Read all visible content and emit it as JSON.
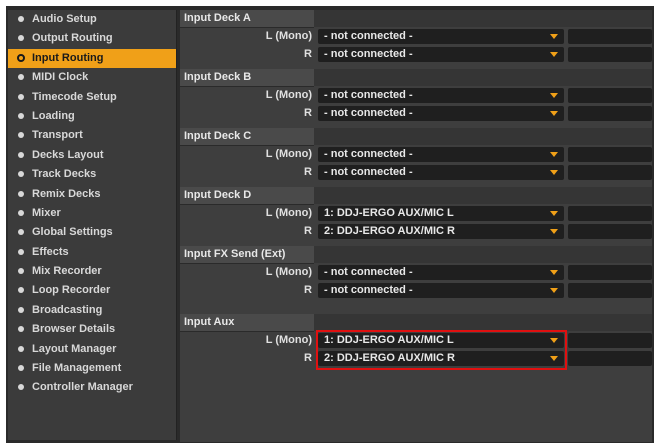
{
  "sidebar": {
    "items": [
      {
        "label": "Audio Setup"
      },
      {
        "label": "Output Routing"
      },
      {
        "label": "Input Routing",
        "active": true
      },
      {
        "label": "MIDI Clock"
      },
      {
        "label": "Timecode Setup"
      },
      {
        "label": "Loading"
      },
      {
        "label": "Transport"
      },
      {
        "label": "Decks Layout"
      },
      {
        "label": "Track Decks"
      },
      {
        "label": "Remix Decks"
      },
      {
        "label": "Mixer"
      },
      {
        "label": "Global Settings"
      },
      {
        "label": "Effects"
      },
      {
        "label": "Mix Recorder"
      },
      {
        "label": "Loop Recorder"
      },
      {
        "label": "Broadcasting"
      },
      {
        "label": "Browser Details"
      },
      {
        "label": "Layout Manager"
      },
      {
        "label": "File Management"
      },
      {
        "label": "Controller Manager"
      }
    ]
  },
  "sections": [
    {
      "title": "Input Deck A",
      "rows": [
        {
          "label": "L (Mono)",
          "value": "- not connected -"
        },
        {
          "label": "R",
          "value": "- not connected -"
        }
      ]
    },
    {
      "title": "Input Deck B",
      "rows": [
        {
          "label": "L (Mono)",
          "value": "- not connected -"
        },
        {
          "label": "R",
          "value": "- not connected -"
        }
      ]
    },
    {
      "title": "Input Deck C",
      "rows": [
        {
          "label": "L (Mono)",
          "value": "- not connected -"
        },
        {
          "label": "R",
          "value": "- not connected -"
        }
      ]
    },
    {
      "title": "Input Deck D",
      "rows": [
        {
          "label": "L (Mono)",
          "value": "1: DDJ-ERGO AUX/MIC L"
        },
        {
          "label": "R",
          "value": "2: DDJ-ERGO AUX/MIC R"
        }
      ]
    },
    {
      "title": "Input FX Send (Ext)",
      "rows": [
        {
          "label": "L (Mono)",
          "value": "- not connected -"
        },
        {
          "label": "R",
          "value": "- not connected -"
        }
      ]
    },
    {
      "title": "Input Aux",
      "rows": [
        {
          "label": "L (Mono)",
          "value": "1: DDJ-ERGO AUX/MIC L"
        },
        {
          "label": "R",
          "value": "2: DDJ-ERGO AUX/MIC R"
        }
      ],
      "highlighted": true
    }
  ],
  "colors": {
    "accent": "#f0a018",
    "highlight": "#e01010",
    "panel": "#3e3e3e"
  }
}
